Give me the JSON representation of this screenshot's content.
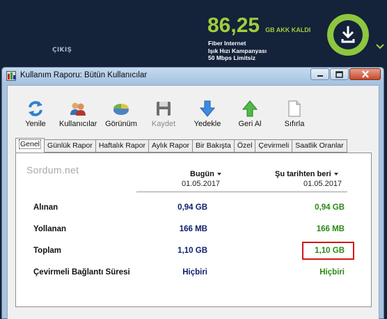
{
  "banner": {
    "logout_label": "ÇIKIŞ",
    "remaining_value": "86,25",
    "remaining_unit": "GB AKK KALDI",
    "plan_lines": [
      "Fiber Internet",
      "Işık Hızı Kampanyası",
      "50 Mbps Limitsiz"
    ],
    "download_icon": "download-icon",
    "accent_color": "#9fcf3b"
  },
  "window": {
    "title": "Kullanım Raporu: Bütün Kullanıcılar",
    "controls": [
      "minimize",
      "maximize",
      "close"
    ]
  },
  "toolbar": {
    "items": [
      {
        "label": "Yenile",
        "icon": "refresh-icon",
        "enabled": true
      },
      {
        "label": "Kullanıcılar",
        "icon": "users-icon",
        "enabled": true
      },
      {
        "label": "Görünüm",
        "icon": "pie-chart-icon",
        "enabled": true
      },
      {
        "label": "Kaydet",
        "icon": "floppy-disk-icon",
        "enabled": false
      },
      {
        "label": "Yedekle",
        "icon": "down-arrow-icon",
        "enabled": true
      },
      {
        "label": "Geri Al",
        "icon": "up-arrow-icon",
        "enabled": true
      },
      {
        "label": "Sıfırla",
        "icon": "blank-page-icon",
        "enabled": true
      }
    ]
  },
  "tabs": [
    {
      "label": "Genel",
      "active": true
    },
    {
      "label": "Günlük Rapor",
      "active": false
    },
    {
      "label": "Haftalık Rapor",
      "active": false
    },
    {
      "label": "Aylık Rapor",
      "active": false
    },
    {
      "label": "Bir Bakışta",
      "active": false
    },
    {
      "label": "Özel",
      "active": false
    },
    {
      "label": "Çevirmeli",
      "active": false
    },
    {
      "label": "Saatlik Oranlar",
      "active": false
    }
  ],
  "report": {
    "watermark": "Sordum.net",
    "columns": [
      {
        "title": "Bugün",
        "date": "01.05.2017"
      },
      {
        "title": "Şu tarihten beri",
        "date": "01.05.2017"
      }
    ],
    "rows": [
      {
        "label": "Alınan",
        "today": "0,94 GB",
        "since": "0,94 GB"
      },
      {
        "label": "Yollanan",
        "today": "166 MB",
        "since": "166 MB"
      },
      {
        "label": "Toplam",
        "today": "1,10 GB",
        "since": "1,10 GB"
      },
      {
        "label": "Çevirmeli Bağlantı Süresi",
        "today": "Hiçbiri",
        "since": "Hiçbiri"
      }
    ],
    "today_color": "#10206f",
    "since_color": "#2a8a14",
    "highlight_color": "#d71414"
  }
}
